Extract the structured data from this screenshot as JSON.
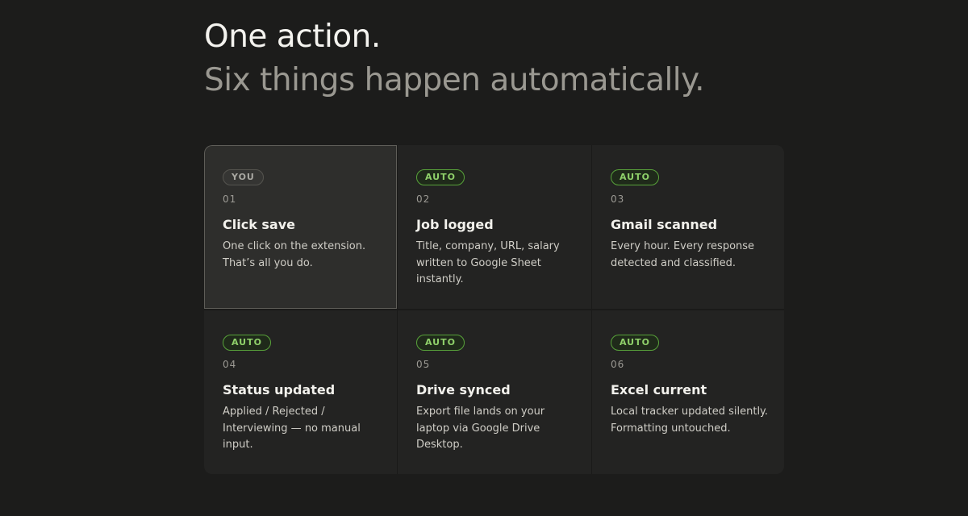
{
  "heading": {
    "line1": "One action.",
    "line2": "Six things happen automatically."
  },
  "colors": {
    "background": "#1c1c1b",
    "card": "#232322",
    "active_card": "#2e2e2c",
    "auto_badge": "#8fd06a",
    "you_badge": "#a9a8a2"
  },
  "steps": [
    {
      "badge": "YOU",
      "number": "01",
      "title": "Click save",
      "description": "One click on the extension. That’s all you do."
    },
    {
      "badge": "AUTO",
      "number": "02",
      "title": "Job logged",
      "description": "Title, company, URL, salary written to Google Sheet instantly."
    },
    {
      "badge": "AUTO",
      "number": "03",
      "title": "Gmail scanned",
      "description": "Every hour. Every response detected and classified."
    },
    {
      "badge": "AUTO",
      "number": "04",
      "title": "Status updated",
      "description": "Applied / Rejected / Interviewing — no manual input."
    },
    {
      "badge": "AUTO",
      "number": "05",
      "title": "Drive synced",
      "description": "Export file lands on your laptop via Google Drive Desktop."
    },
    {
      "badge": "AUTO",
      "number": "06",
      "title": "Excel current",
      "description": "Local tracker updated silently. Formatting untouched."
    }
  ]
}
